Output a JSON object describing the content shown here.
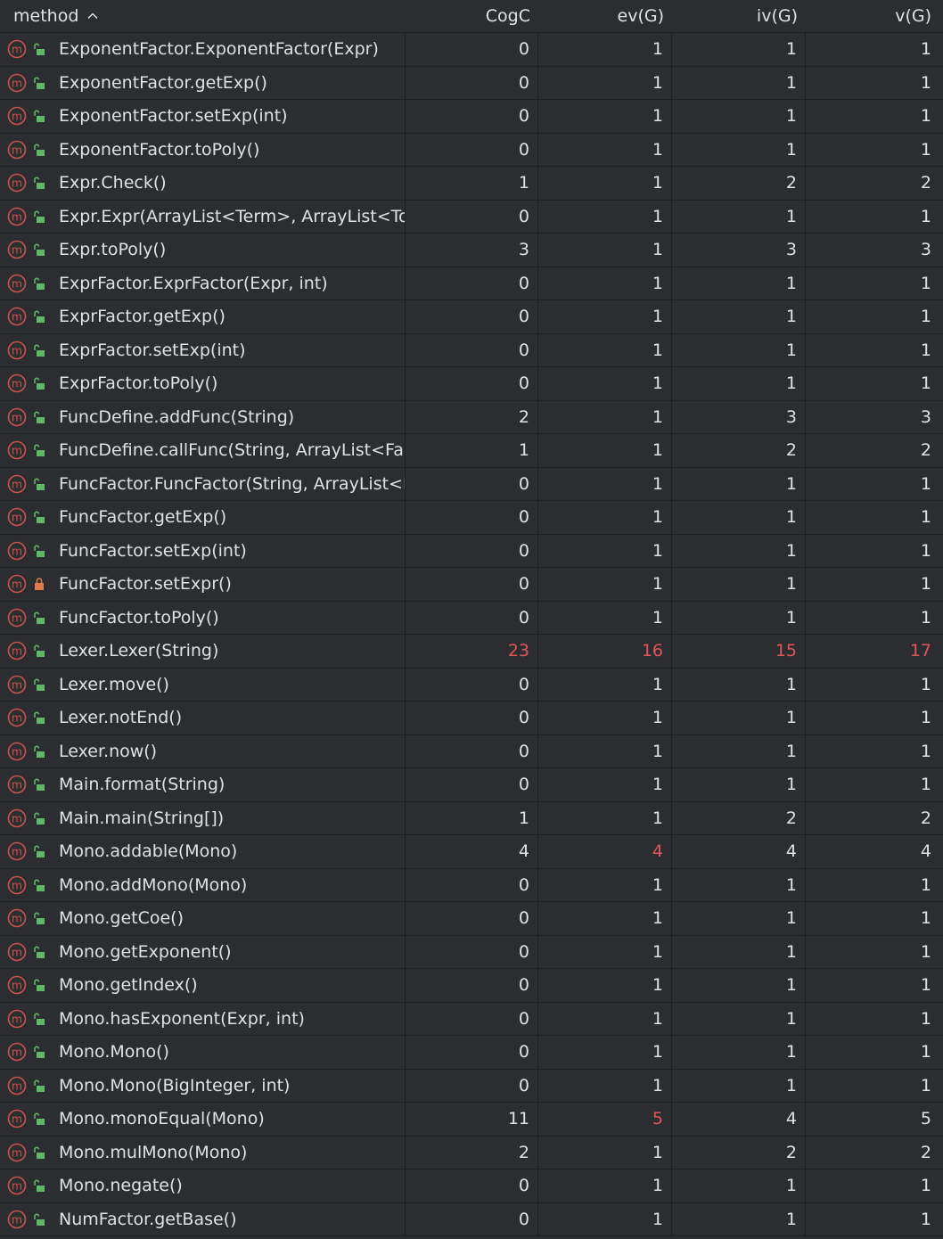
{
  "columns": {
    "method": "method",
    "cogc": "CogC",
    "ev": "ev(G)",
    "iv": "iv(G)",
    "v": "v(G)"
  },
  "colors": {
    "background": "#2b2d30",
    "text": "#dfe1e5",
    "highlight_red": "#e0565b",
    "method_icon": "#c75450",
    "lock_open": "#5fb865",
    "lock_private": "#e07b4b"
  },
  "rows": [
    {
      "method": "ExponentFactor.ExponentFactor(Expr)",
      "access": "public",
      "cogc": "0",
      "ev": "1",
      "iv": "1",
      "v": "1",
      "red": []
    },
    {
      "method": "ExponentFactor.getExp()",
      "access": "public",
      "cogc": "0",
      "ev": "1",
      "iv": "1",
      "v": "1",
      "red": []
    },
    {
      "method": "ExponentFactor.setExp(int)",
      "access": "public",
      "cogc": "0",
      "ev": "1",
      "iv": "1",
      "v": "1",
      "red": []
    },
    {
      "method": "ExponentFactor.toPoly()",
      "access": "public",
      "cogc": "0",
      "ev": "1",
      "iv": "1",
      "v": "1",
      "red": []
    },
    {
      "method": "Expr.Check()",
      "access": "public",
      "cogc": "1",
      "ev": "1",
      "iv": "2",
      "v": "2",
      "red": []
    },
    {
      "method": "Expr.Expr(ArrayList<Term>, ArrayList<Tok",
      "access": "public",
      "cogc": "0",
      "ev": "1",
      "iv": "1",
      "v": "1",
      "red": []
    },
    {
      "method": "Expr.toPoly()",
      "access": "public",
      "cogc": "3",
      "ev": "1",
      "iv": "3",
      "v": "3",
      "red": []
    },
    {
      "method": "ExprFactor.ExprFactor(Expr, int)",
      "access": "public",
      "cogc": "0",
      "ev": "1",
      "iv": "1",
      "v": "1",
      "red": []
    },
    {
      "method": "ExprFactor.getExp()",
      "access": "public",
      "cogc": "0",
      "ev": "1",
      "iv": "1",
      "v": "1",
      "red": []
    },
    {
      "method": "ExprFactor.setExp(int)",
      "access": "public",
      "cogc": "0",
      "ev": "1",
      "iv": "1",
      "v": "1",
      "red": []
    },
    {
      "method": "ExprFactor.toPoly()",
      "access": "public",
      "cogc": "0",
      "ev": "1",
      "iv": "1",
      "v": "1",
      "red": []
    },
    {
      "method": "FuncDefine.addFunc(String)",
      "access": "public",
      "cogc": "2",
      "ev": "1",
      "iv": "3",
      "v": "3",
      "red": []
    },
    {
      "method": "FuncDefine.callFunc(String, ArrayList<Fact",
      "access": "public",
      "cogc": "1",
      "ev": "1",
      "iv": "2",
      "v": "2",
      "red": []
    },
    {
      "method": "FuncFactor.FuncFactor(String, ArrayList<F",
      "access": "public",
      "cogc": "0",
      "ev": "1",
      "iv": "1",
      "v": "1",
      "red": []
    },
    {
      "method": "FuncFactor.getExp()",
      "access": "public",
      "cogc": "0",
      "ev": "1",
      "iv": "1",
      "v": "1",
      "red": []
    },
    {
      "method": "FuncFactor.setExp(int)",
      "access": "public",
      "cogc": "0",
      "ev": "1",
      "iv": "1",
      "v": "1",
      "red": []
    },
    {
      "method": "FuncFactor.setExpr()",
      "access": "private",
      "cogc": "0",
      "ev": "1",
      "iv": "1",
      "v": "1",
      "red": []
    },
    {
      "method": "FuncFactor.toPoly()",
      "access": "public",
      "cogc": "0",
      "ev": "1",
      "iv": "1",
      "v": "1",
      "red": []
    },
    {
      "method": "Lexer.Lexer(String)",
      "access": "public",
      "cogc": "23",
      "ev": "16",
      "iv": "15",
      "v": "17",
      "red": [
        "cogc",
        "ev",
        "iv",
        "v"
      ]
    },
    {
      "method": "Lexer.move()",
      "access": "public",
      "cogc": "0",
      "ev": "1",
      "iv": "1",
      "v": "1",
      "red": []
    },
    {
      "method": "Lexer.notEnd()",
      "access": "public",
      "cogc": "0",
      "ev": "1",
      "iv": "1",
      "v": "1",
      "red": []
    },
    {
      "method": "Lexer.now()",
      "access": "public",
      "cogc": "0",
      "ev": "1",
      "iv": "1",
      "v": "1",
      "red": []
    },
    {
      "method": "Main.format(String)",
      "access": "public",
      "cogc": "0",
      "ev": "1",
      "iv": "1",
      "v": "1",
      "red": []
    },
    {
      "method": "Main.main(String[])",
      "access": "public",
      "cogc": "1",
      "ev": "1",
      "iv": "2",
      "v": "2",
      "red": []
    },
    {
      "method": "Mono.addable(Mono)",
      "access": "public",
      "cogc": "4",
      "ev": "4",
      "iv": "4",
      "v": "4",
      "red": [
        "ev"
      ]
    },
    {
      "method": "Mono.addMono(Mono)",
      "access": "public",
      "cogc": "0",
      "ev": "1",
      "iv": "1",
      "v": "1",
      "red": []
    },
    {
      "method": "Mono.getCoe()",
      "access": "public",
      "cogc": "0",
      "ev": "1",
      "iv": "1",
      "v": "1",
      "red": []
    },
    {
      "method": "Mono.getExponent()",
      "access": "public",
      "cogc": "0",
      "ev": "1",
      "iv": "1",
      "v": "1",
      "red": []
    },
    {
      "method": "Mono.getIndex()",
      "access": "public",
      "cogc": "0",
      "ev": "1",
      "iv": "1",
      "v": "1",
      "red": []
    },
    {
      "method": "Mono.hasExponent(Expr, int)",
      "access": "public",
      "cogc": "0",
      "ev": "1",
      "iv": "1",
      "v": "1",
      "red": []
    },
    {
      "method": "Mono.Mono()",
      "access": "public",
      "cogc": "0",
      "ev": "1",
      "iv": "1",
      "v": "1",
      "red": []
    },
    {
      "method": "Mono.Mono(BigInteger, int)",
      "access": "public",
      "cogc": "0",
      "ev": "1",
      "iv": "1",
      "v": "1",
      "red": []
    },
    {
      "method": "Mono.monoEqual(Mono)",
      "access": "public",
      "cogc": "11",
      "ev": "5",
      "iv": "4",
      "v": "5",
      "red": [
        "ev"
      ]
    },
    {
      "method": "Mono.mulMono(Mono)",
      "access": "public",
      "cogc": "2",
      "ev": "1",
      "iv": "2",
      "v": "2",
      "red": []
    },
    {
      "method": "Mono.negate()",
      "access": "public",
      "cogc": "0",
      "ev": "1",
      "iv": "1",
      "v": "1",
      "red": []
    },
    {
      "method": "NumFactor.getBase()",
      "access": "public",
      "cogc": "0",
      "ev": "1",
      "iv": "1",
      "v": "1",
      "red": []
    }
  ]
}
